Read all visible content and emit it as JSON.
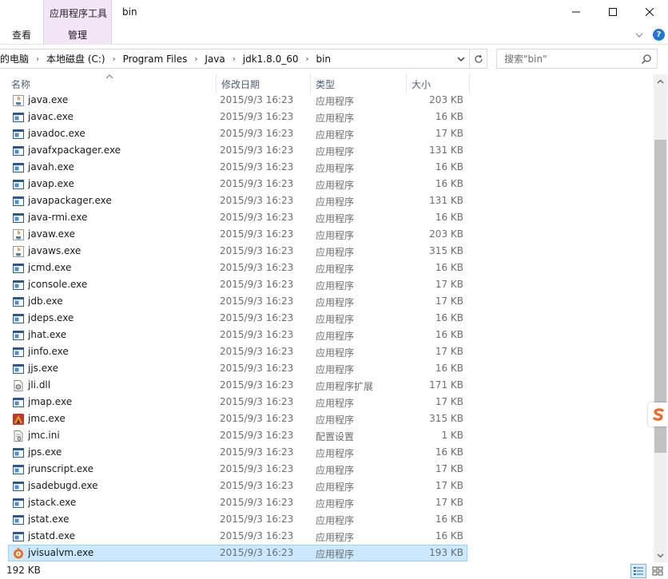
{
  "window": {
    "title": "bin",
    "context_tab_header": "应用程序工具"
  },
  "ribbon": {
    "tab_view": "查看",
    "tab_manage": "管理"
  },
  "address": {
    "crumbs": [
      "的电脑",
      "本地磁盘 (C:)",
      "Program Files",
      "Java",
      "jdk1.8.0_60",
      "bin"
    ],
    "search_placeholder": "搜索\"bin\""
  },
  "columns": {
    "name": "名称",
    "date": "修改日期",
    "type": "类型",
    "size": "大小"
  },
  "files": [
    {
      "name": "java.exe",
      "date": "2015/9/3 16:23",
      "type": "应用程序",
      "size": "203 KB",
      "icon": "java-cup-icon"
    },
    {
      "name": "javac.exe",
      "date": "2015/9/3 16:23",
      "type": "应用程序",
      "size": "16 KB",
      "icon": "exe-window-icon"
    },
    {
      "name": "javadoc.exe",
      "date": "2015/9/3 16:23",
      "type": "应用程序",
      "size": "17 KB",
      "icon": "exe-window-icon"
    },
    {
      "name": "javafxpackager.exe",
      "date": "2015/9/3 16:23",
      "type": "应用程序",
      "size": "131 KB",
      "icon": "exe-window-icon"
    },
    {
      "name": "javah.exe",
      "date": "2015/9/3 16:23",
      "type": "应用程序",
      "size": "16 KB",
      "icon": "exe-window-icon"
    },
    {
      "name": "javap.exe",
      "date": "2015/9/3 16:23",
      "type": "应用程序",
      "size": "16 KB",
      "icon": "exe-window-icon"
    },
    {
      "name": "javapackager.exe",
      "date": "2015/9/3 16:23",
      "type": "应用程序",
      "size": "131 KB",
      "icon": "exe-window-icon"
    },
    {
      "name": "java-rmi.exe",
      "date": "2015/9/3 16:23",
      "type": "应用程序",
      "size": "16 KB",
      "icon": "exe-window-icon"
    },
    {
      "name": "javaw.exe",
      "date": "2015/9/3 16:23",
      "type": "应用程序",
      "size": "203 KB",
      "icon": "java-cup-icon"
    },
    {
      "name": "javaws.exe",
      "date": "2015/9/3 16:23",
      "type": "应用程序",
      "size": "315 KB",
      "icon": "java-cup-icon"
    },
    {
      "name": "jcmd.exe",
      "date": "2015/9/3 16:23",
      "type": "应用程序",
      "size": "16 KB",
      "icon": "exe-window-icon"
    },
    {
      "name": "jconsole.exe",
      "date": "2015/9/3 16:23",
      "type": "应用程序",
      "size": "17 KB",
      "icon": "exe-window-icon"
    },
    {
      "name": "jdb.exe",
      "date": "2015/9/3 16:23",
      "type": "应用程序",
      "size": "17 KB",
      "icon": "exe-window-icon"
    },
    {
      "name": "jdeps.exe",
      "date": "2015/9/3 16:23",
      "type": "应用程序",
      "size": "16 KB",
      "icon": "exe-window-icon"
    },
    {
      "name": "jhat.exe",
      "date": "2015/9/3 16:23",
      "type": "应用程序",
      "size": "16 KB",
      "icon": "exe-window-icon"
    },
    {
      "name": "jinfo.exe",
      "date": "2015/9/3 16:23",
      "type": "应用程序",
      "size": "17 KB",
      "icon": "exe-window-icon"
    },
    {
      "name": "jjs.exe",
      "date": "2015/9/3 16:23",
      "type": "应用程序",
      "size": "16 KB",
      "icon": "exe-window-icon"
    },
    {
      "name": "jli.dll",
      "date": "2015/9/3 16:23",
      "type": "应用程序扩展",
      "size": "171 KB",
      "icon": "dll-gear-icon"
    },
    {
      "name": "jmap.exe",
      "date": "2015/9/3 16:23",
      "type": "应用程序",
      "size": "17 KB",
      "icon": "exe-window-icon"
    },
    {
      "name": "jmc.exe",
      "date": "2015/9/3 16:23",
      "type": "应用程序",
      "size": "315 KB",
      "icon": "jmc-flame-icon"
    },
    {
      "name": "jmc.ini",
      "date": "2015/9/3 16:23",
      "type": "配置设置",
      "size": "1 KB",
      "icon": "ini-settings-icon"
    },
    {
      "name": "jps.exe",
      "date": "2015/9/3 16:23",
      "type": "应用程序",
      "size": "16 KB",
      "icon": "exe-window-icon"
    },
    {
      "name": "jrunscript.exe",
      "date": "2015/9/3 16:23",
      "type": "应用程序",
      "size": "17 KB",
      "icon": "exe-window-icon"
    },
    {
      "name": "jsadebugd.exe",
      "date": "2015/9/3 16:23",
      "type": "应用程序",
      "size": "17 KB",
      "icon": "exe-window-icon"
    },
    {
      "name": "jstack.exe",
      "date": "2015/9/3 16:23",
      "type": "应用程序",
      "size": "17 KB",
      "icon": "exe-window-icon"
    },
    {
      "name": "jstat.exe",
      "date": "2015/9/3 16:23",
      "type": "应用程序",
      "size": "16 KB",
      "icon": "exe-window-icon"
    },
    {
      "name": "jstatd.exe",
      "date": "2015/9/3 16:23",
      "type": "应用程序",
      "size": "16 KB",
      "icon": "exe-window-icon"
    },
    {
      "name": "jvisualvm.exe",
      "date": "2015/9/3 16:23",
      "type": "应用程序",
      "size": "193 KB",
      "icon": "jvisualvm-icon",
      "selected": true
    }
  ],
  "status": {
    "selection_size": "192 KB"
  },
  "colors": {
    "selection_bg": "#cce8ff",
    "selection_border": "#99d1ff",
    "context_tab_bg": "#f3e6f6",
    "header_text": "#4c607a",
    "secondary_text": "#6d6d6d"
  }
}
